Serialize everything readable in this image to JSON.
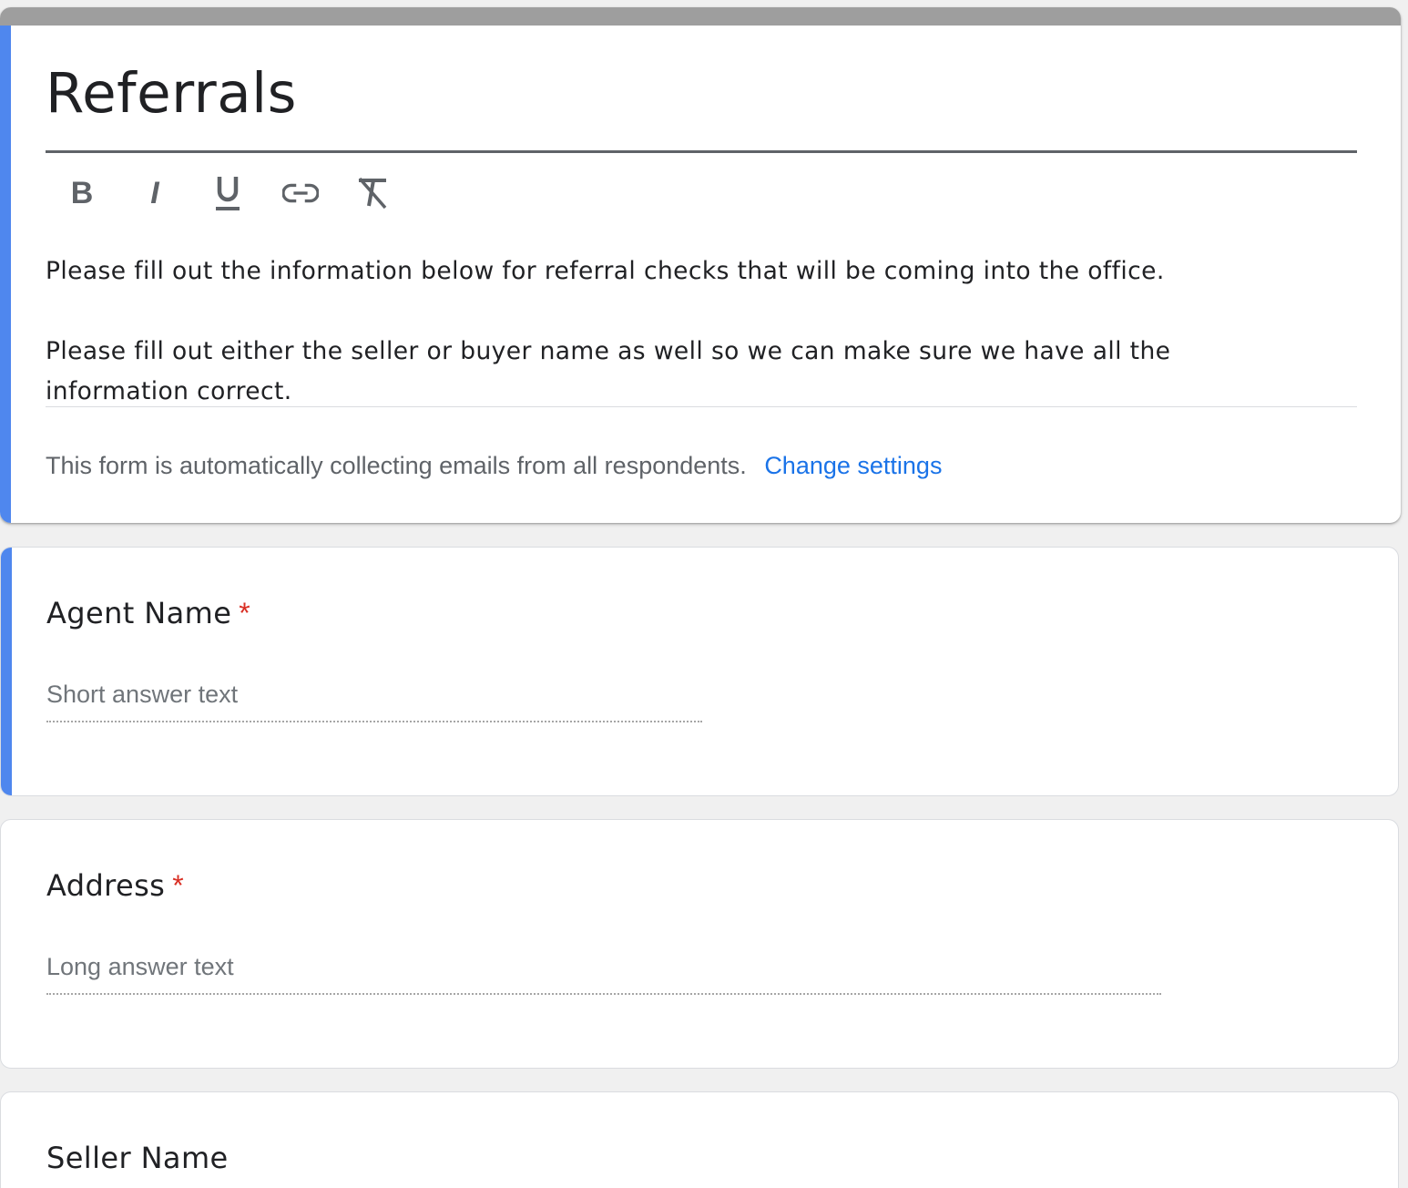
{
  "form": {
    "title": "Referrals",
    "toolbar": {
      "bold_label": "B",
      "italic_label": "I",
      "underline_label": "U"
    },
    "description": {
      "line1": "Please fill out the information below for referral checks that will be coming into the office.",
      "line2": "Please fill out either the seller or buyer name as well so we can make sure we have all the",
      "line3": "information correct."
    },
    "email_notice": "This form is automatically collecting emails from all respondents.",
    "change_settings_label": "Change settings"
  },
  "questions": [
    {
      "title": "Agent Name",
      "required_mark": "*",
      "placeholder": "Short answer text",
      "type": "short"
    },
    {
      "title": "Address",
      "required_mark": "*",
      "placeholder": "Long answer text",
      "type": "long"
    },
    {
      "title": "Seller Name",
      "type": "short"
    }
  ],
  "colors": {
    "accent": "#4f87ee",
    "header_bar": "#9e9e9e",
    "link": "#1a73e8",
    "required": "#d93025",
    "background": "#f0f0f0"
  }
}
